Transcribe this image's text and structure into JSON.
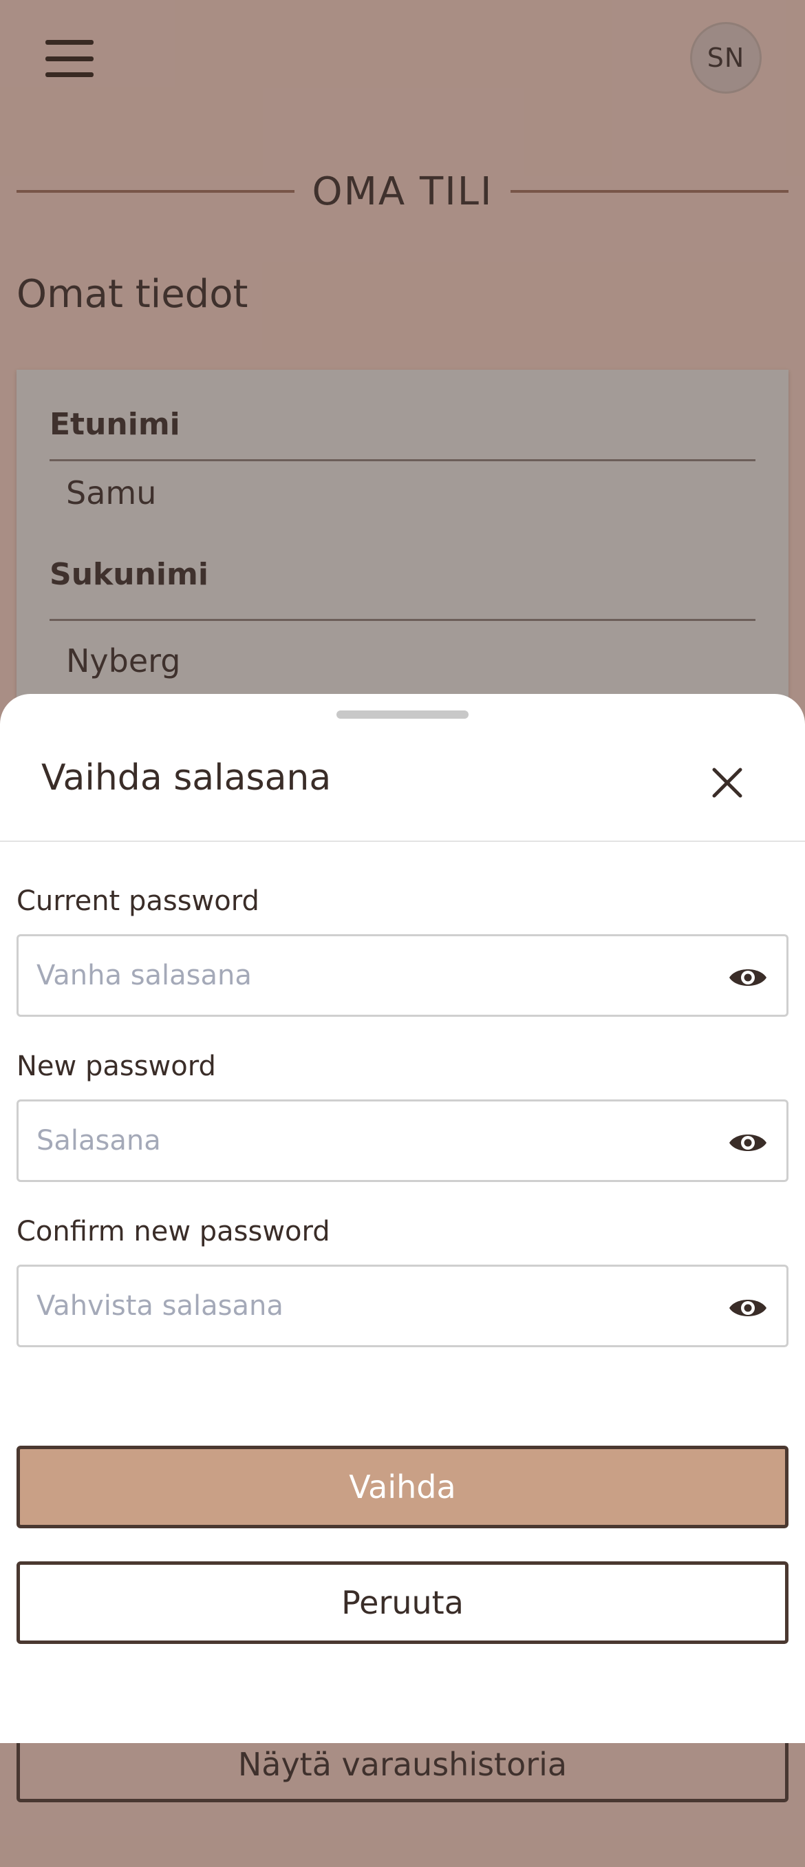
{
  "header": {
    "avatar_initials": "SN"
  },
  "page": {
    "section_title": "OMA TILI",
    "heading": "Omat tiedot",
    "fields": [
      {
        "label": "Etunimi",
        "value": "Samu"
      },
      {
        "label": "Sukunimi",
        "value": "Nyberg"
      }
    ],
    "history_button": "Näytä varaushistoria"
  },
  "dialog": {
    "title": "Vaihda salasana",
    "fields": [
      {
        "label": "Current password",
        "placeholder": "Vanha salasana",
        "value": ""
      },
      {
        "label": "New password",
        "placeholder": "Salasana",
        "value": ""
      },
      {
        "label": "Confirm new password",
        "placeholder": "Vahvista salasana",
        "value": ""
      }
    ],
    "submit_label": "Vaihda",
    "cancel_label": "Peruuta"
  },
  "colors": {
    "page_background": "#fad6c8",
    "primary_button": "#c9a086",
    "text": "#3a2d28"
  },
  "icons": {
    "menu": "hamburger-menu-icon",
    "close": "close-icon",
    "password_toggle": "eye-icon"
  }
}
